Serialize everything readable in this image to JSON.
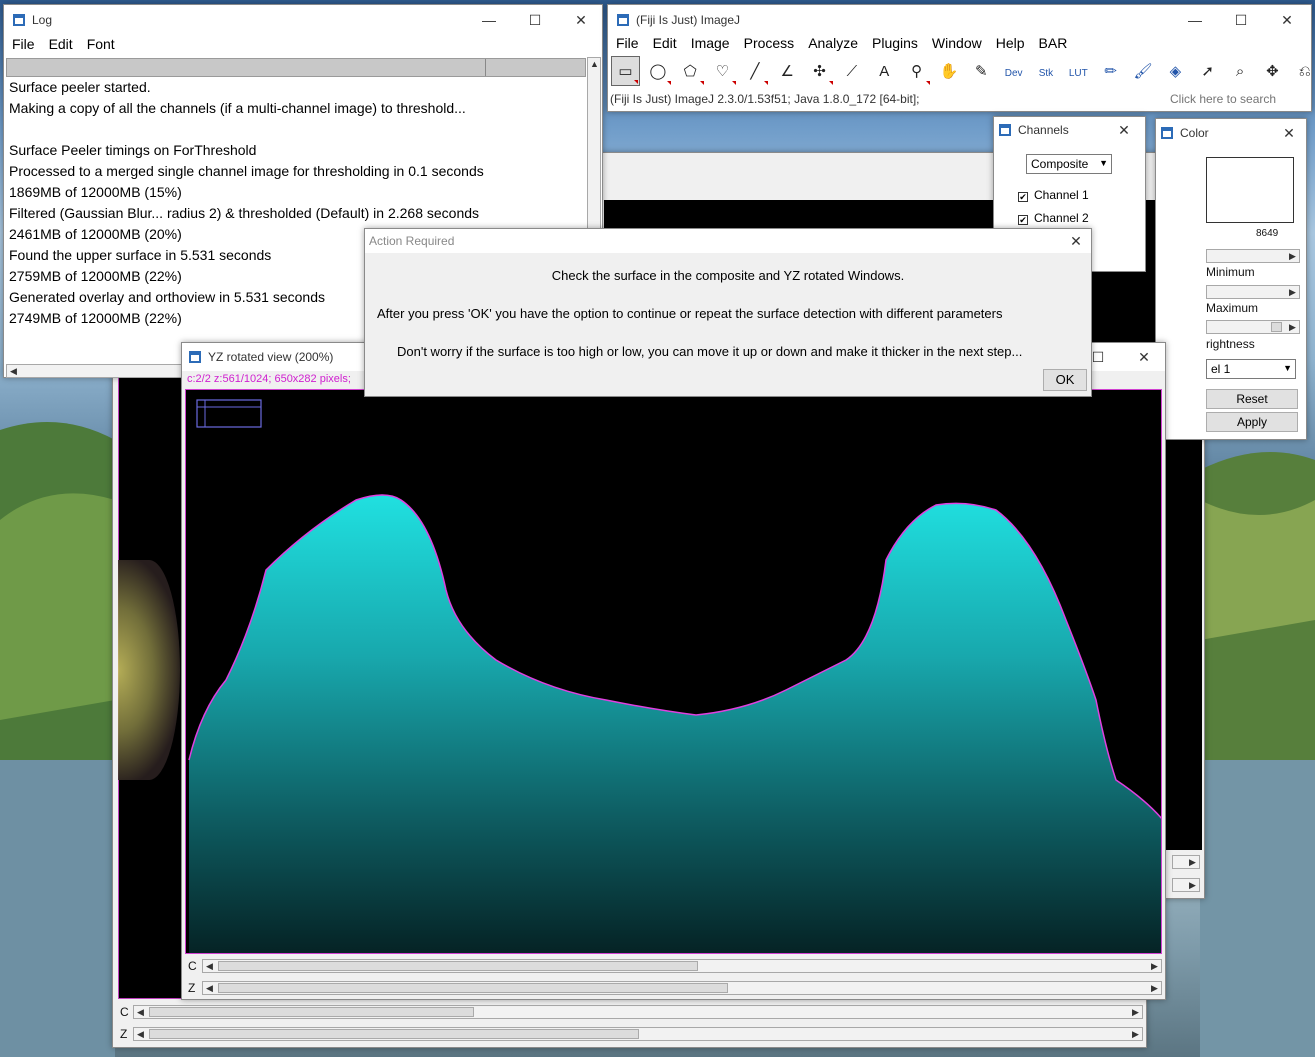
{
  "log": {
    "title": "Log",
    "menu": [
      "File",
      "Edit",
      "Font"
    ],
    "lines": [
      "Surface peeler started.",
      "Making a copy of all the channels (if a multi-channel image) to threshold...",
      "",
      "Surface Peeler timings on ForThreshold",
      "Processed to a merged single channel image for thresholding in 0.1 seconds",
      "1869MB of 12000MB (15%)",
      "Filtered (Gaussian Blur... radius 2) & thresholded (Default) in 2.268 seconds",
      "2461MB of 12000MB (20%)",
      "Found the upper surface in 5.531 seconds",
      "2759MB of 12000MB (22%)",
      "Generated overlay and orthoview in 5.531 seconds",
      "2749MB of 12000MB (22%)"
    ]
  },
  "imagej": {
    "title": "(Fiji Is Just) ImageJ",
    "menu": [
      "File",
      "Edit",
      "Image",
      "Process",
      "Analyze",
      "Plugins",
      "Window",
      "Help",
      "BAR"
    ],
    "status": "(Fiji Is Just) ImageJ 2.3.0/1.53f51; Java 1.8.0_172 [64-bit];",
    "search_placeholder": "Click here to search",
    "tools": [
      "rectangle-tool-icon",
      "oval-tool-icon",
      "polygon-tool-icon",
      "freehand-tool-icon",
      "line-tool-icon",
      "angle-tool-icon",
      "point-tool-icon",
      "wand-tool-icon",
      "text-tool-icon",
      "magnifier-tool-icon",
      "hand-tool-icon",
      "color-picker-icon",
      "dev-menu-icon",
      "stk-menu-icon",
      "lut-menu-icon",
      "pencil-tool-icon",
      "brush-tool-icon",
      "flood-fill-icon",
      "arrow-tool-icon",
      "search-tool-icon",
      "move-tool-icon",
      "overlay-tool-icon",
      "more-tools-icon"
    ],
    "tool_text": {
      "dev": "Dev",
      "stk": "Stk",
      "lut": "LUT",
      "text": "A"
    }
  },
  "channels": {
    "title": "Channels",
    "mode": "Composite",
    "items": [
      "Channel 1",
      "Channel 2"
    ]
  },
  "color": {
    "title": "Color",
    "value": "8649",
    "minimum": "Minimum",
    "maximum": "Maximum",
    "brightness": "rightness",
    "select": "el 1",
    "reset": "Reset",
    "apply": "Apply"
  },
  "dialog": {
    "title": "Action Required",
    "line1": "Check the surface in the composite and YZ rotated Windows.",
    "line2": "After you press 'OK' you have the option to continue or repeat the surface detection with different parameters",
    "line3": "Don't worry if the surface is too high or low, you can move it up or down and make it thicker in the next step...",
    "ok": "OK"
  },
  "yz": {
    "title": "YZ rotated view (200%)",
    "info": "c:2/2 z:561/1024; 650x282 pixels;",
    "c_label": "C",
    "z_label": "Z"
  },
  "back": {
    "c_label": "C",
    "z_label": "Z"
  },
  "colors": {
    "cyan": "#1fd6d6",
    "magenta": "#e040e0",
    "accent": "#2c6bb7"
  }
}
